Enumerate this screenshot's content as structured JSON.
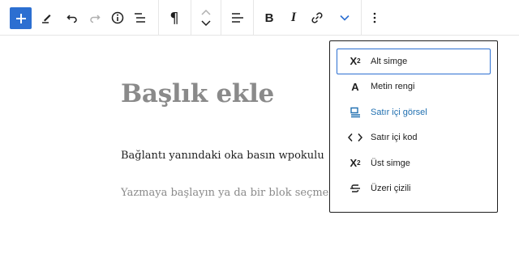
{
  "toolbar": {
    "add_block": "plus-icon",
    "bold_label": "B",
    "italic_label": "I",
    "paragraph_glyph": "¶",
    "accent_color": "#2c6fd1"
  },
  "editor": {
    "title": "Başlık ekle",
    "paragraph": "Bağlantı yanındaki oka basın wpokulu",
    "placeholder": "Yazmaya başlayın ya da bir blok seçmek için"
  },
  "menu": {
    "items": [
      {
        "label": "Alt simge",
        "icon": "subscript-icon"
      },
      {
        "label": "Metin rengi",
        "icon": "text-color-icon"
      },
      {
        "label": "Satır içi görsel",
        "icon": "inline-image-icon"
      },
      {
        "label": "Satır içi kod",
        "icon": "code-icon"
      },
      {
        "label": "Üst simge",
        "icon": "superscript-icon"
      },
      {
        "label": "Üzeri çizili",
        "icon": "strikethrough-icon"
      }
    ],
    "focused_index": 0,
    "active_color": "#2271b1"
  }
}
